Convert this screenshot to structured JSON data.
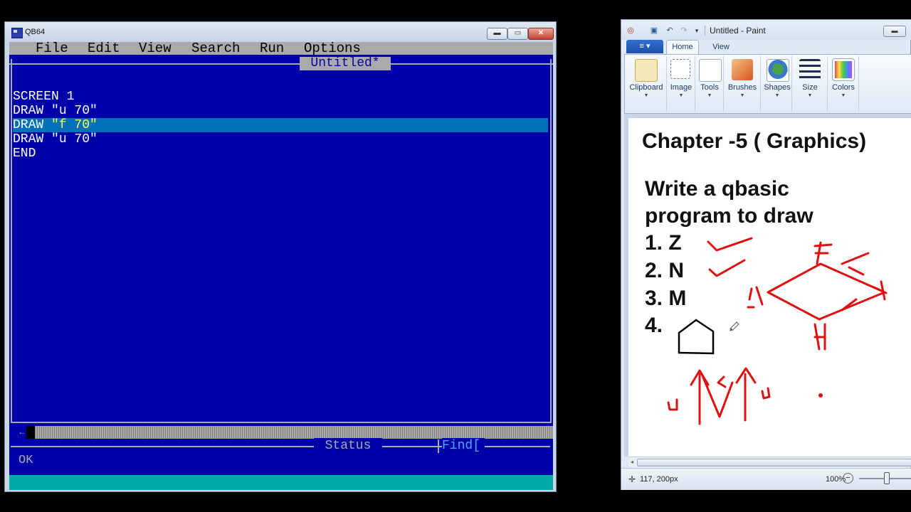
{
  "qb64": {
    "window_title": "QB64",
    "window_buttons": {
      "minimize": "▬",
      "maximize": "▭",
      "close": "✕"
    },
    "menu": {
      "file": "File",
      "edit": "Edit",
      "view": "View",
      "search": "Search",
      "run": "Run",
      "options": "Options"
    },
    "document_title": "Untitled*",
    "code": [
      {
        "kw": "SCREEN 1",
        "str": ""
      },
      {
        "kw": "DRAW ",
        "str": "\"u 70\""
      },
      {
        "kw": "DRAW ",
        "str": "\"f 70\""
      },
      {
        "kw": "DRAW ",
        "str": "\"u 70\""
      },
      {
        "kw": "END",
        "str": ""
      }
    ],
    "scroll_left_arrow": "←",
    "status_label": "Status",
    "find_label": "Find[",
    "output_text": "OK",
    "colors": {
      "background": "#0000a8",
      "text": "#ffffff",
      "selected_line": "#0070b8",
      "status_bar": "#00a8a8"
    }
  },
  "paint": {
    "window_title": "Untitled - Paint",
    "file_tab_icon": "≡ ▾",
    "tabs": {
      "home": "Home",
      "view": "View"
    },
    "ribbon": {
      "clipboard": "Clipboard",
      "image": "Image",
      "tools": "Tools",
      "brushes": "Brushes",
      "shapes": "Shapes",
      "size": "Size",
      "colors": "Colors",
      "dropdown_arrow": "▼"
    },
    "canvas": {
      "heading": "Chapter -5 ( Graphics)",
      "line1": "Write a qbasic",
      "line2": "program to draw",
      "items": [
        "1.  Z",
        "2.  N",
        "3.  M",
        "4."
      ]
    },
    "status": {
      "cursor_position": "117, 200px",
      "zoom": "100%",
      "zoom_out": "−",
      "position_icon": "✛"
    },
    "qat_icons": {
      "paint": "◎",
      "save": "▣",
      "undo": "↶",
      "redo": "↷",
      "more": "▾"
    },
    "min_button": "▬",
    "scroll_left": "◂",
    "colors": {
      "annotation_ink": "#e01010"
    }
  }
}
